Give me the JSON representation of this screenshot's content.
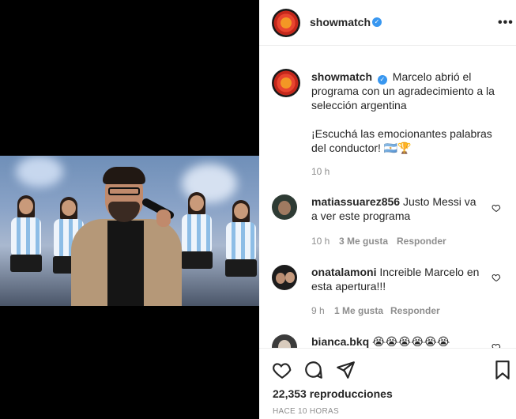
{
  "header": {
    "username": "showmatch",
    "more_icon": "more-horizontal-icon"
  },
  "caption": {
    "username": "showmatch",
    "text_1": "Marcelo abrió el programa con un agradecimiento a la selección argentina",
    "text_2": "¡Escuchá las emocionantes palabras del conductor! 🇦🇷🏆",
    "flag_text": "AR",
    "time": "10 h"
  },
  "comments": [
    {
      "username": "matiassuarez856",
      "text": "Justo Messi va a ver este programa",
      "time": "10 h",
      "likes": "3 Me gusta",
      "reply": "Responder"
    },
    {
      "username": "onatalamoni",
      "text": "Increible Marcelo en esta apertura!!!",
      "time": "9 h",
      "likes": "1 Me gusta",
      "reply": "Responder"
    },
    {
      "username": "bianca.bkq",
      "text": "😭😭😭😭😭😭"
    }
  ],
  "footer": {
    "views": "22,353 reproducciones",
    "timestamp": "HACE 10 HORAS"
  },
  "colors": {
    "verified": "#3897f0",
    "meta_text": "#8e8e8e",
    "primary_text": "#262626"
  }
}
